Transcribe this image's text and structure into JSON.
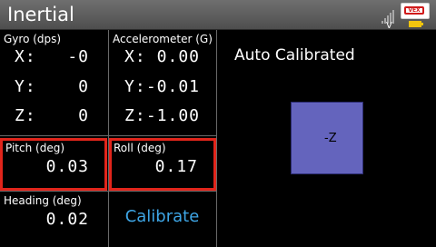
{
  "app": {
    "title": "Inertial"
  },
  "status_icons": {
    "signal": "signal-bars-icon",
    "signal_label": "V",
    "brand": "vex-logo-icon",
    "battery": "battery-icon",
    "logo_text": "VEX"
  },
  "gyro": {
    "label": "Gyro (dps)",
    "rows": [
      {
        "axis": "X:",
        "value": "-0"
      },
      {
        "axis": "Y:",
        "value": "0"
      },
      {
        "axis": "Z:",
        "value": "0"
      }
    ]
  },
  "accelerometer": {
    "label": "Accelerometer (G)",
    "rows": [
      {
        "axis": "X:",
        "value": "0.00"
      },
      {
        "axis": "Y:",
        "value": "-0.01"
      },
      {
        "axis": "Z:",
        "value": "-1.00"
      }
    ]
  },
  "pitch": {
    "label": "Pitch (deg)",
    "value": "0.03"
  },
  "roll": {
    "label": "Roll (deg)",
    "value": "0.17"
  },
  "heading": {
    "label": "Heading (deg)",
    "value": "0.02"
  },
  "calibrate_label": "Calibrate",
  "calibration_status": "Auto Calibrated",
  "orientation_face": "-Z",
  "colors": {
    "highlight": "#e1251b",
    "calibrate": "#3ea6e6",
    "cube": "#6464bd",
    "battery": "#f1c40f"
  }
}
